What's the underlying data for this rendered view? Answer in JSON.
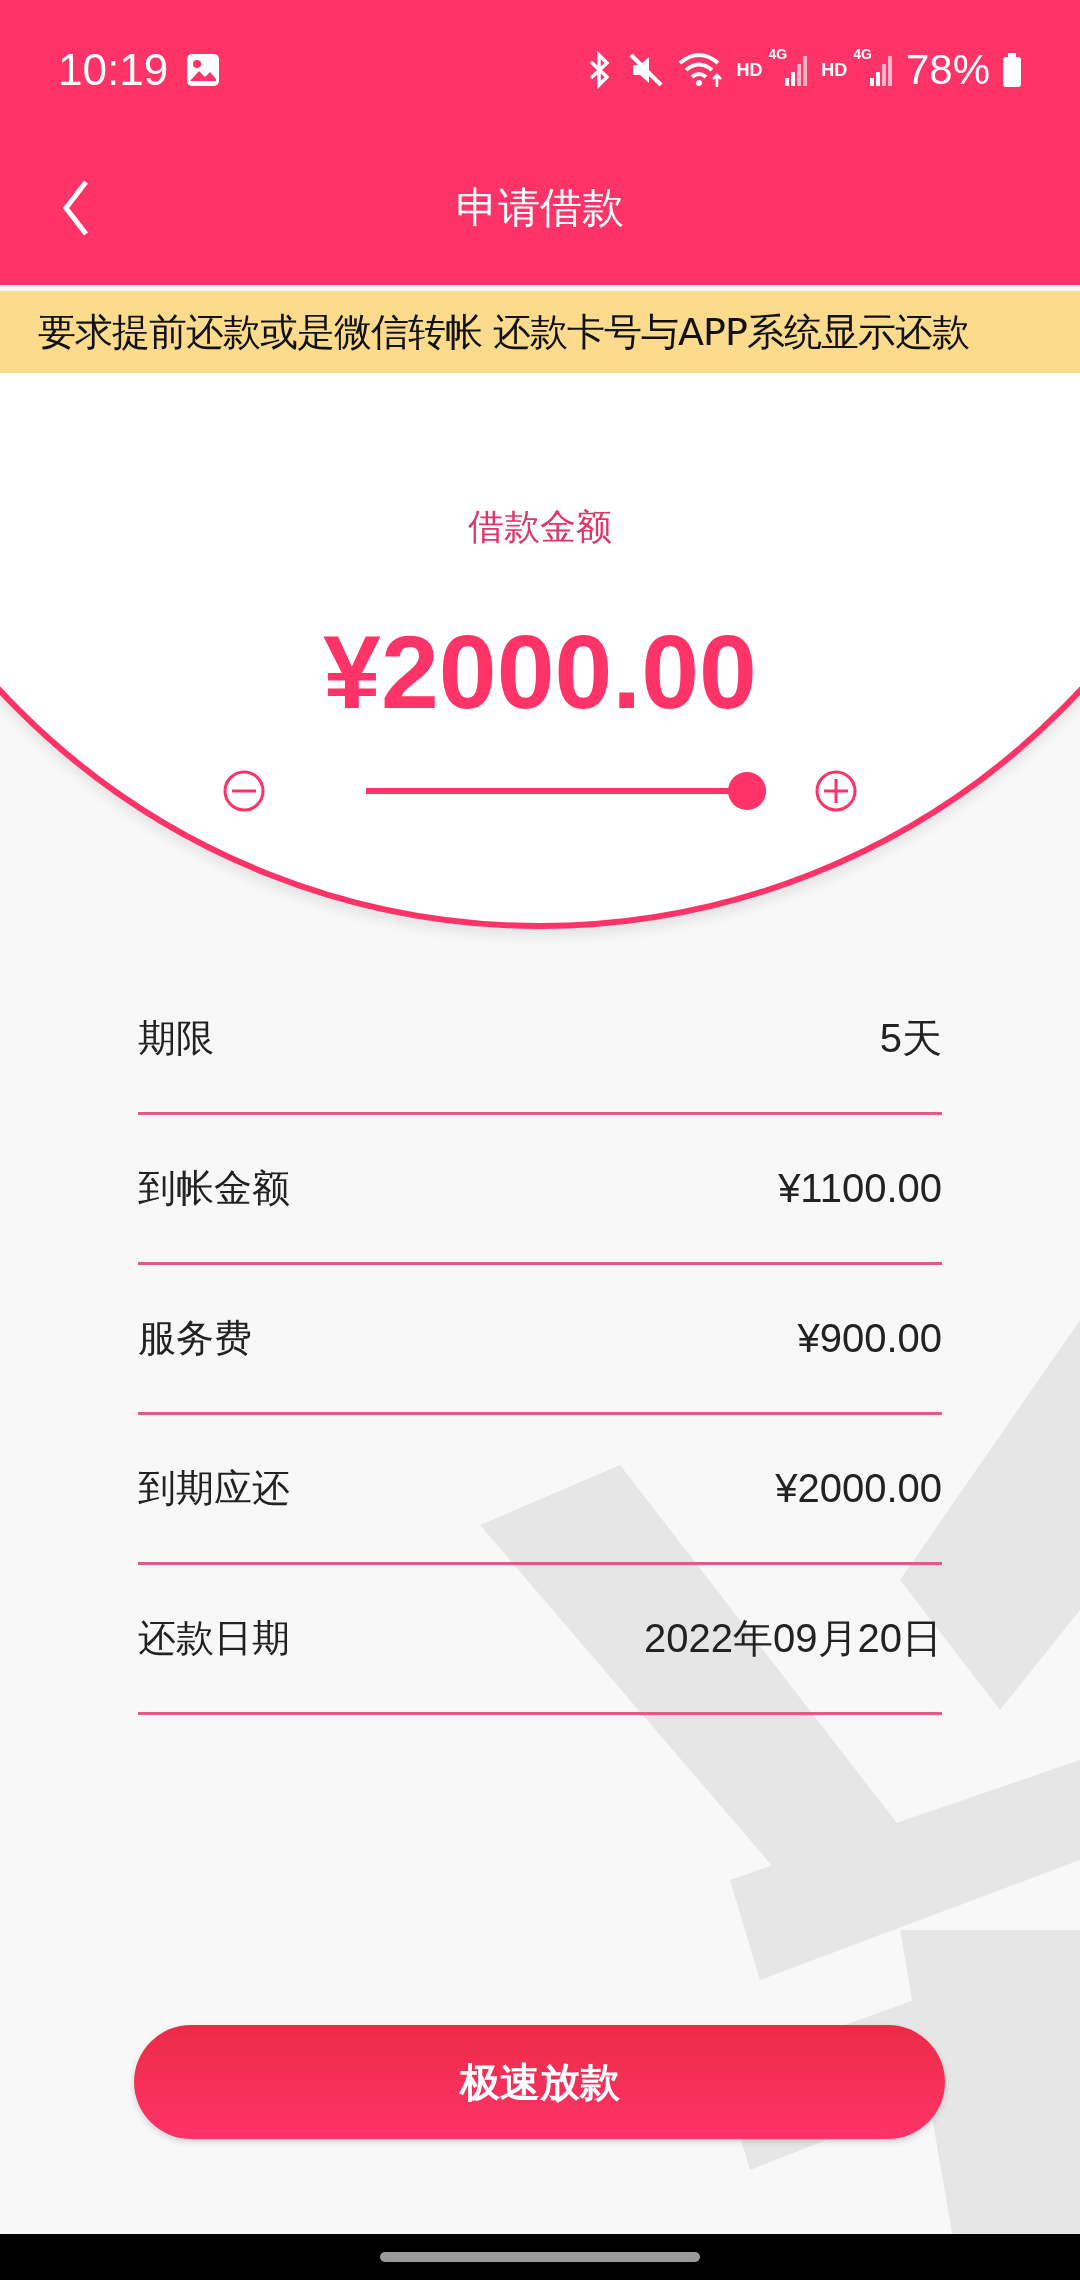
{
  "status_bar": {
    "time": "10:19",
    "network": [
      {
        "hd": "HD",
        "gen": "4G"
      },
      {
        "hd": "HD",
        "gen": "4G"
      }
    ],
    "battery": "78%"
  },
  "header": {
    "title": "申请借款"
  },
  "notice": {
    "text": "要求提前还款或是微信转帐 还款卡号与APP系统显示还款"
  },
  "amount": {
    "label": "借款金额",
    "value": "¥2000.00",
    "level": 1
  },
  "details": [
    {
      "label": "期限",
      "value": "5天"
    },
    {
      "label": "到帐金额",
      "value": "¥1100.00"
    },
    {
      "label": "服务费",
      "value": "¥900.00"
    },
    {
      "label": "到期应还",
      "value": "¥2000.00"
    },
    {
      "label": "还款日期",
      "value": "2022年09月20日"
    }
  ],
  "submit": {
    "label": "极速放款"
  }
}
